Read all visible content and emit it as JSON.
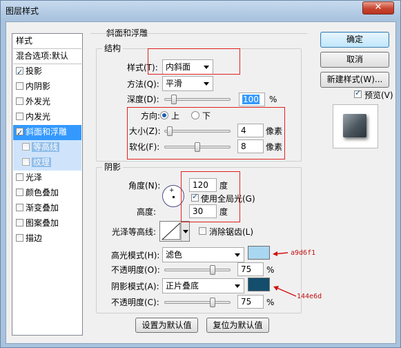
{
  "window": {
    "title": "图层样式",
    "close": "✕"
  },
  "style_list": {
    "header": "样式",
    "blend_options": "混合选项:默认",
    "items": [
      {
        "label": "投影",
        "checked": true
      },
      {
        "label": "内阴影",
        "checked": false
      },
      {
        "label": "外发光",
        "checked": false
      },
      {
        "label": "内发光",
        "checked": false
      },
      {
        "label": "斜面和浮雕",
        "checked": true,
        "selected": true
      },
      {
        "label": "等高线",
        "checked": false,
        "sub": true
      },
      {
        "label": "纹理",
        "checked": false,
        "sub": true
      },
      {
        "label": "光泽",
        "checked": false
      },
      {
        "label": "颜色叠加",
        "checked": false
      },
      {
        "label": "渐变叠加",
        "checked": false
      },
      {
        "label": "图案叠加",
        "checked": false
      },
      {
        "label": "描边",
        "checked": false
      }
    ]
  },
  "bevel": {
    "title": "斜面和浮雕",
    "structure": {
      "title": "结构",
      "style_label": "样式(T):",
      "style_value": "内斜面",
      "technique_label": "方法(Q):",
      "technique_value": "平滑",
      "depth_label": "深度(D):",
      "depth_value": "100",
      "depth_unit": "%",
      "direction_label": "方向:",
      "direction_up": "上",
      "direction_down": "下",
      "size_label": "大小(Z):",
      "size_value": "4",
      "size_unit": "像素",
      "soften_label": "软化(F):",
      "soften_value": "8",
      "soften_unit": "像素",
      "depth_slider_fraction": 0.1,
      "size_slider_fraction": 0.03,
      "soften_slider_fraction": 0.5
    },
    "shading": {
      "title": "阴影",
      "angle_label": "角度(N):",
      "angle_value": "120",
      "angle_unit": "度",
      "global_light_label": "使用全局光(G)",
      "global_light_checked": true,
      "altitude_label": "高度:",
      "altitude_value": "30",
      "altitude_unit": "度",
      "gloss_contour_label": "光泽等高线:",
      "anti_alias_label": "消除锯齿(L)",
      "highlight_mode_label": "高光模式(H):",
      "highlight_mode_value": "滤色",
      "highlight_color": "#a9d6f1",
      "highlight_opacity_label": "不透明度(O):",
      "highlight_opacity_value": "75",
      "highlight_opacity_unit": "%",
      "shadow_mode_label": "阴影模式(A):",
      "shadow_mode_value": "正片叠底",
      "shadow_color": "#144e6d",
      "shadow_opacity_label": "不透明度(C):",
      "shadow_opacity_value": "75",
      "shadow_opacity_unit": "%",
      "highlight_opacity_fraction": 0.75,
      "shadow_opacity_fraction": 0.75
    },
    "make_default": "设置为默认值",
    "reset_default": "复位为默认值"
  },
  "right_panel": {
    "ok": "确定",
    "cancel": "取消",
    "new_style": "新建样式(W)...",
    "preview_label": "预览(V)",
    "preview_checked": true
  },
  "annotations": {
    "highlight_hex": "a9d6f1",
    "shadow_hex": "144e6d"
  }
}
